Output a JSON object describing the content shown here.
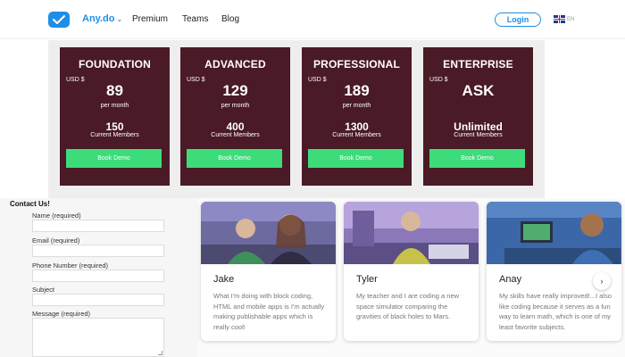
{
  "header": {
    "brand": "Any.do",
    "nav": [
      "Premium",
      "Teams",
      "Blog"
    ],
    "login_label": "Login",
    "language_code": "EN"
  },
  "plans": [
    {
      "name": "FOUNDATION",
      "currency": "USD $",
      "price": "89",
      "period": "per month",
      "members": "150",
      "members_label": "Current Members",
      "button": "Book Demo"
    },
    {
      "name": "ADVANCED",
      "currency": "USD $",
      "price": "129",
      "period": "per month",
      "members": "400",
      "members_label": "Current Members",
      "button": "Book Demo"
    },
    {
      "name": "PROFESSIONAL",
      "currency": "USD $",
      "price": "189",
      "period": "per month",
      "members": "1300",
      "members_label": "Current Members",
      "button": "Book Demo"
    },
    {
      "name": "ENTERPRISE",
      "currency": "USD $",
      "price": "ASK",
      "period": "",
      "members": "Unlimited",
      "members_label": "Current Members",
      "button": "Book Demo"
    }
  ],
  "contact": {
    "title": "Contact Us!",
    "fields": {
      "name": "Name (required)",
      "email": "Email (required)",
      "phone": "Phone Number (required)",
      "subject": "Subject",
      "message": "Message (required)"
    }
  },
  "testimonials": [
    {
      "name": "Jake",
      "quote": "What I'm doing with block coding, HTML and mobile apps is I'm actually making publishable apps which is really cool!"
    },
    {
      "name": "Tyler",
      "quote": "My teacher and I are coding a new space simulator comparing the gravities of black holes to Mars."
    },
    {
      "name": "Anay",
      "quote": "My skills have really improved!...I also like coding because it serves as a fun way to learn math, which is one of my least favorite subjects."
    }
  ],
  "colors": {
    "brand_blue": "#1f8fe5",
    "plan_bg": "#4a1a26",
    "button_green": "#3ddc7a"
  },
  "icons": {
    "logo": "checkmark-icon",
    "next": "chevron-right-icon"
  }
}
